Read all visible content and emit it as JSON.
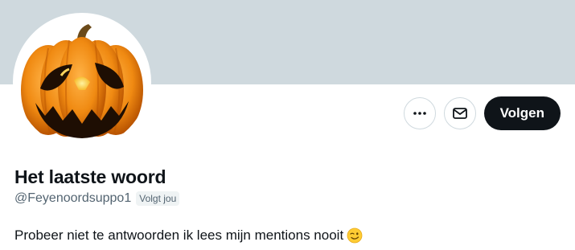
{
  "profile": {
    "display_name": "Het laatste woord",
    "handle": "@Feyenoordsuppo1",
    "follows_you_badge": "Volgt jou",
    "bio": "Probeer niet te antwoorden ik lees mijn mentions nooit",
    "bio_emoji": "winking-face-emoji",
    "avatar": "jack-o-lantern-pumpkin"
  },
  "actions": {
    "more_icon": "more-horizontal-icon",
    "message_icon": "envelope-icon",
    "follow_label": "Volgen"
  },
  "colors": {
    "banner": "#cfd9de",
    "follow_button_bg": "#0f1419",
    "secondary_text": "#536471",
    "badge_bg": "#eff3f4",
    "pumpkin": "#e8790d"
  }
}
